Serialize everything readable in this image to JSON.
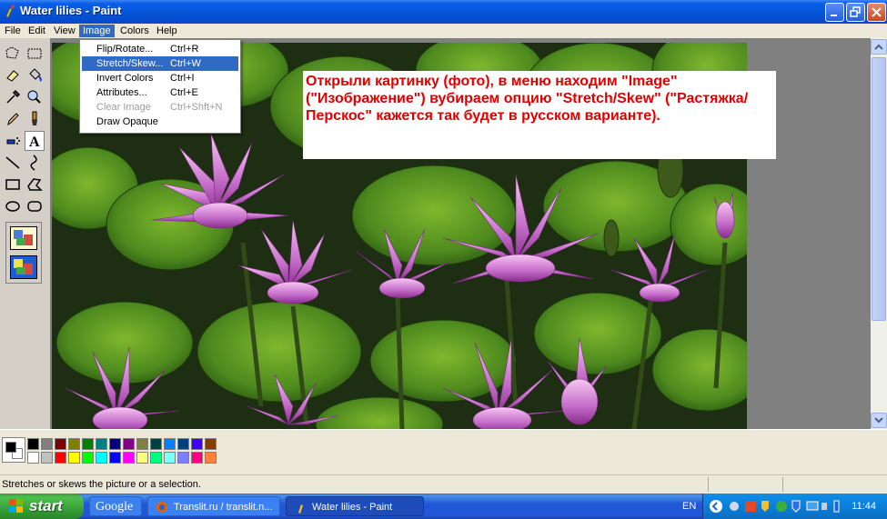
{
  "window": {
    "title": "Water lilies - Paint"
  },
  "menubar": {
    "items": [
      "File",
      "Edit",
      "View",
      "Image",
      "Colors",
      "Help"
    ],
    "active": "Image"
  },
  "image_menu": {
    "items": [
      {
        "label": "Flip/Rotate...",
        "shortcut": "Ctrl+R",
        "state": "normal"
      },
      {
        "label": "Stretch/Skew...",
        "shortcut": "Ctrl+W",
        "state": "highlighted"
      },
      {
        "label": "Invert Colors",
        "shortcut": "Ctrl+I",
        "state": "normal"
      },
      {
        "label": "Attributes...",
        "shortcut": "Ctrl+E",
        "state": "normal"
      },
      {
        "label": "Clear Image",
        "shortcut": "Ctrl+Shft+N",
        "state": "disabled"
      },
      {
        "label": "Draw Opaque",
        "shortcut": "",
        "state": "normal"
      }
    ]
  },
  "annotation": {
    "text": "Открыли картинку (фото), в меню находим \"Image\" (\"Изображение\") вубираем опцию \"Stretch/Skew\" (\"Растяжка/Перскос\" кажется так будет в русском варианте).",
    "color": "#e00000"
  },
  "toolbox": {
    "tools": [
      "free-select",
      "rect-select",
      "eraser",
      "fill",
      "color-picker",
      "magnifier",
      "pencil",
      "brush",
      "airbrush",
      "text",
      "line",
      "curve",
      "rectangle",
      "polygon",
      "ellipse",
      "rounded-rect"
    ],
    "selected": "text"
  },
  "palette": {
    "foreground": "#000000",
    "background": "#ffffff",
    "row1": [
      "#000000",
      "#808080",
      "#800000",
      "#808000",
      "#008000",
      "#008080",
      "#000080",
      "#800080",
      "#808040",
      "#004040",
      "#0080ff",
      "#004080",
      "#4000ff",
      "#804000"
    ],
    "row2": [
      "#ffffff",
      "#c0c0c0",
      "#ff0000",
      "#ffff00",
      "#00ff00",
      "#00ffff",
      "#0000ff",
      "#ff00ff",
      "#ffff80",
      "#00ff80",
      "#80ffff",
      "#8080ff",
      "#ff0080",
      "#ff8040"
    ]
  },
  "statusbar": {
    "text": "Stretches or skews the picture or a selection."
  },
  "taskbar": {
    "start_label": "start",
    "buttons": [
      {
        "label": "Google"
      },
      {
        "label": "Translit.ru / translit.n..."
      },
      {
        "label": "Water lilies - Paint"
      }
    ],
    "language": "EN",
    "clock": "11:44"
  }
}
